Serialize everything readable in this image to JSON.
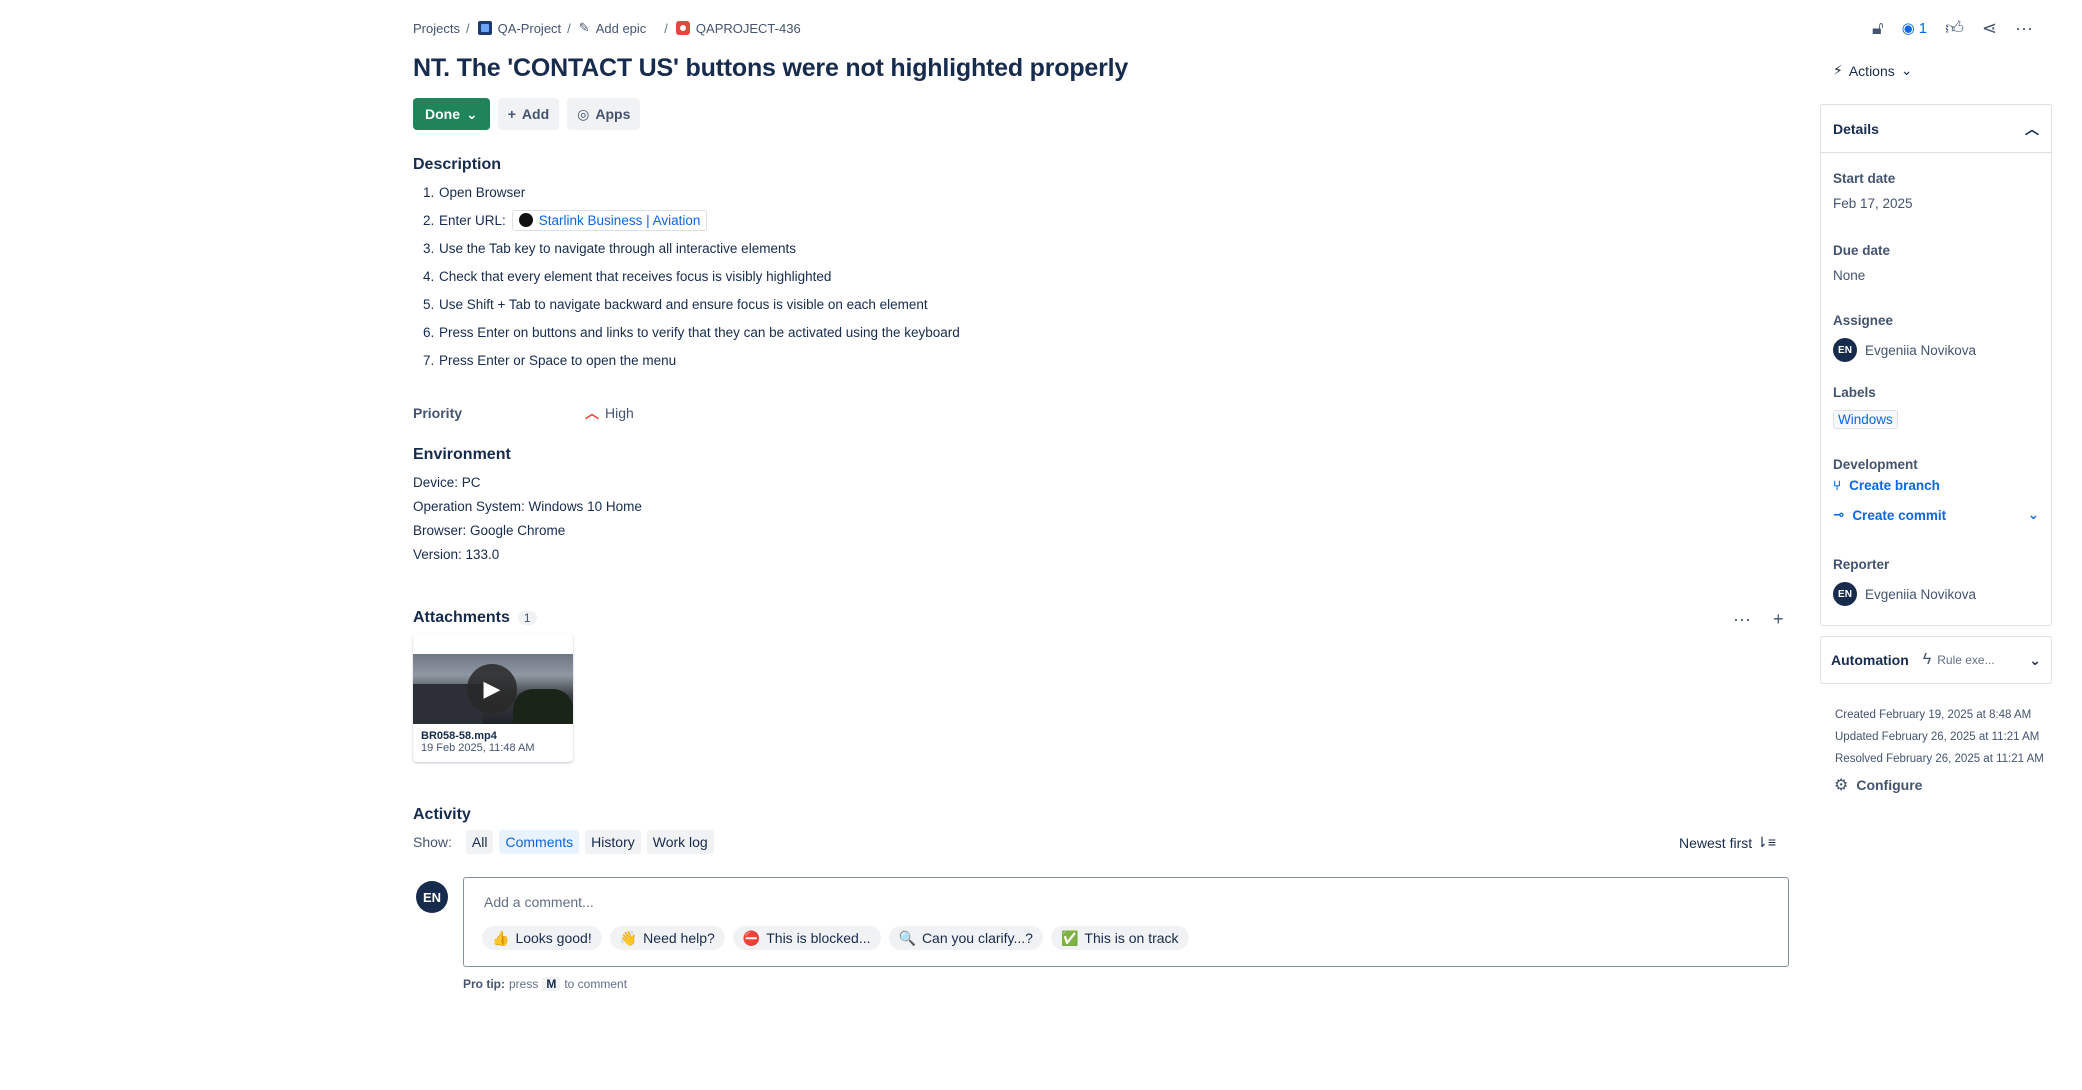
{
  "breadcrumb": {
    "projects": "Projects",
    "project": "QA-Project",
    "add_epic": "Add epic",
    "issue_key": "QAPROJECT-436"
  },
  "issue": {
    "title": "NT. The 'CONTACT US' buttons were not highlighted properly"
  },
  "toolbar": {
    "status": "Done",
    "add": "Add",
    "apps": "Apps"
  },
  "description": {
    "heading": "Description",
    "steps": [
      {
        "num": "1.",
        "text": "Open Browser"
      },
      {
        "num": "2.",
        "text": "Enter URL:"
      },
      {
        "num": "3.",
        "text": "Use the Tab key to navigate through all interactive elements"
      },
      {
        "num": "4.",
        "text": "Check that every element that receives focus is visibly highlighted"
      },
      {
        "num": "5.",
        "text": "Use Shift + Tab to navigate backward and ensure focus is visible on each element"
      },
      {
        "num": "6.",
        "text": "Press Enter on buttons and links to verify that they can be activated using the keyboard"
      },
      {
        "num": "7.",
        "text": "Press Enter or Space to open the menu"
      }
    ],
    "url_link": "Starlink Business | Aviation"
  },
  "priority": {
    "label": "Priority",
    "value": "High"
  },
  "environment": {
    "heading": "Environment",
    "lines": [
      "Device: PC",
      "Operation System: Windows 10 Home",
      "Browser: Google Chrome",
      "Version: 133.0"
    ]
  },
  "attachments": {
    "heading": "Attachments",
    "count": "1",
    "file_name": "BR058-58.mp4",
    "file_date": "19 Feb 2025, 11:48 AM"
  },
  "activity": {
    "heading": "Activity",
    "show_label": "Show:",
    "filters": [
      "All",
      "Comments",
      "History",
      "Work log"
    ],
    "active_filter": "Comments",
    "sort": "Newest first",
    "avatar_initials": "EN",
    "comment_placeholder": "Add a comment...",
    "quick_replies": [
      {
        "icon": "👍",
        "label": "Looks good!"
      },
      {
        "icon": "👋",
        "label": "Need help?"
      },
      {
        "icon": "⛔",
        "label": "This is blocked..."
      },
      {
        "icon": "🔍",
        "label": "Can you clarify...?"
      },
      {
        "icon": "✅",
        "label": "This is on track"
      }
    ],
    "pro_tip_label": "Pro tip:",
    "pro_tip_press": "press",
    "pro_tip_key": "M",
    "pro_tip_suffix": "to comment"
  },
  "header_actions": {
    "watch_count": "1",
    "actions_label": "Actions"
  },
  "details": {
    "heading": "Details",
    "start_date_label": "Start date",
    "start_date": "Feb 17, 2025",
    "due_date_label": "Due date",
    "due_date": "None",
    "assignee_label": "Assignee",
    "assignee_initials": "EN",
    "assignee": "Evgeniia Novikova",
    "labels_label": "Labels",
    "label_value": "Windows",
    "development_label": "Development",
    "create_branch": "Create branch",
    "create_commit": "Create commit",
    "reporter_label": "Reporter",
    "reporter_initials": "EN",
    "reporter": "Evgeniia Novikova"
  },
  "automation": {
    "label": "Automation",
    "rule": "Rule exe..."
  },
  "meta": {
    "created": "Created February 19, 2025 at 8:48 AM",
    "updated": "Updated February 26, 2025 at 11:21 AM",
    "resolved": "Resolved February 26, 2025 at 11:21 AM",
    "configure": "Configure"
  },
  "colors": {
    "done_green": "#1f845a",
    "link_blue": "#0c66e4",
    "text_dark": "#172b4d",
    "priority_red": "#e2483d"
  }
}
